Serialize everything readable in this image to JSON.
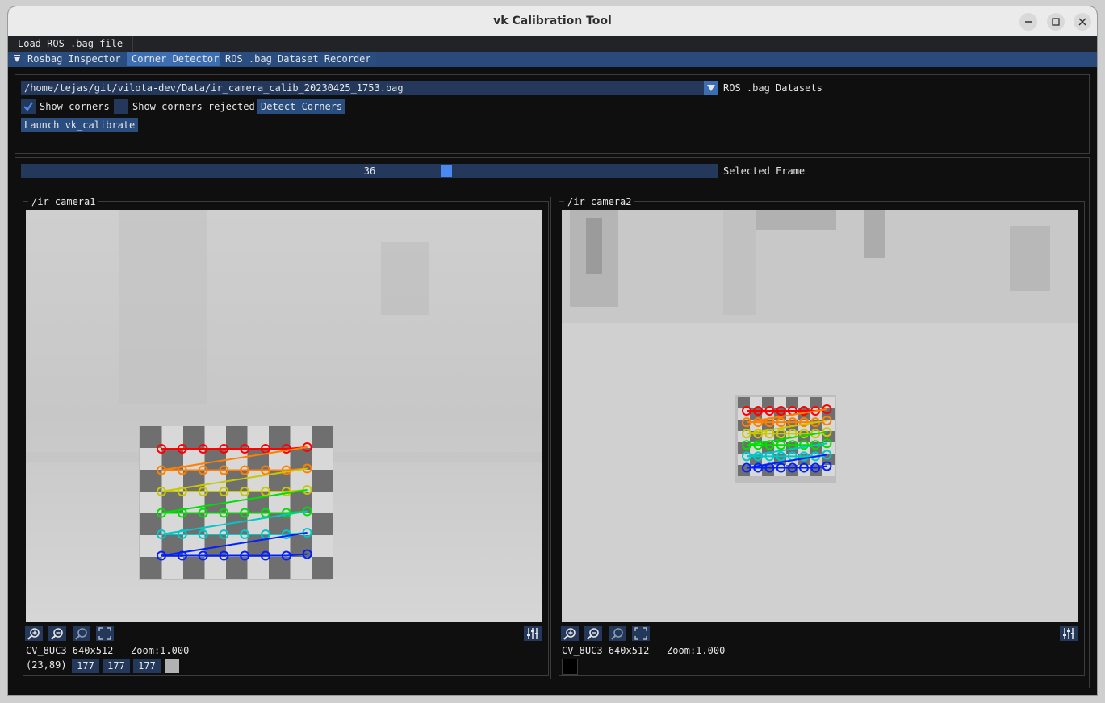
{
  "window": {
    "title": "vk Calibration Tool"
  },
  "menu": {
    "load_label": "Load ROS .bag file"
  },
  "tabs": [
    {
      "label": "Rosbag Inspector",
      "active": false
    },
    {
      "label": "Corner Detector",
      "active": true
    },
    {
      "label": "ROS .bag Dataset Recorder",
      "active": false
    }
  ],
  "controls": {
    "bag_path": "/home/tejas/git/vilota-dev/Data/ir_camera_calib_20230425_1753.bag",
    "bag_combo_label": "ROS .bag Datasets",
    "show_corners_label": "Show corners",
    "show_corners_checked": true,
    "show_rejected_label": "Show corners rejected",
    "show_rejected_checked": false,
    "detect_button": "Detect Corners",
    "launch_button": "Launch vk_calibrate"
  },
  "frame_slider": {
    "value": "36",
    "label": "Selected Frame",
    "fraction": 0.61
  },
  "cameras": [
    {
      "name": "/ir_camera1",
      "info": "CV_8UC3 640x512 - Zoom:1.000",
      "cursor": "(23,89)",
      "pixel": [
        "177",
        "177",
        "177"
      ],
      "swatch_color": "#b1b1b1"
    },
    {
      "name": "/ir_camera2",
      "info": "CV_8UC3 640x512 - Zoom:1.000",
      "swatch_color": "#000000"
    }
  ],
  "icons": [
    "zoom-in-icon",
    "zoom-out-icon",
    "zoom-reset-icon",
    "full-view-icon",
    "adjust-levels-icon"
  ],
  "colors": {
    "accent": "#3c6eb4",
    "frame_bg": "#23385a",
    "row_colors": [
      "#ff0000",
      "#ff8000",
      "#c8c800",
      "#00e000",
      "#00c8c8",
      "#0020ff"
    ]
  }
}
